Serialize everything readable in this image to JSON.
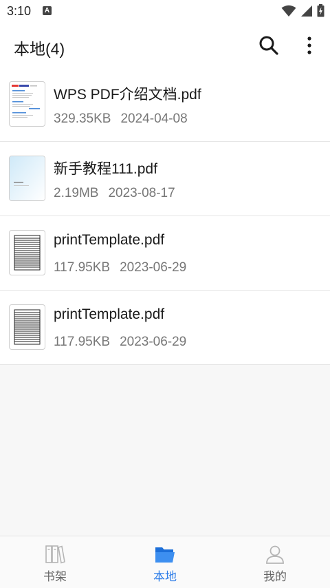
{
  "status_bar": {
    "time": "3:10",
    "notification_badge": "A",
    "icons": [
      "wifi-icon",
      "signal-icon",
      "battery-icon"
    ]
  },
  "header": {
    "title": "本地(4)",
    "icons": [
      "search-icon",
      "more-vert-icon"
    ]
  },
  "files": [
    {
      "name": "WPS PDF介绍文档.pdf",
      "size": "329.35KB",
      "date": "2024-04-08",
      "thumbnail": "wps-doc-thumbnail"
    },
    {
      "name": "新手教程111.pdf",
      "size": "2.19MB",
      "date": "2023-08-17",
      "thumbnail": "tutorial-thumbnail"
    },
    {
      "name": "printTemplate.pdf",
      "size": "117.95KB",
      "date": "2023-06-29",
      "thumbnail": "lined-template-thumbnail"
    },
    {
      "name": "printTemplate.pdf",
      "size": "117.95KB",
      "date": "2023-06-29",
      "thumbnail": "lined-template-thumbnail"
    }
  ],
  "bottom_nav": {
    "items": [
      {
        "label": "书架",
        "icon": "bookshelf-icon",
        "active": false
      },
      {
        "label": "本地",
        "icon": "folder-icon",
        "active": true
      },
      {
        "label": "我的",
        "icon": "profile-icon",
        "active": false
      }
    ]
  },
  "colors": {
    "accent": "#2f7ee8",
    "background": "#f7f7f7",
    "text_primary": "#1a1a1a",
    "text_secondary": "#777777",
    "divider": "#e6e6e6"
  }
}
